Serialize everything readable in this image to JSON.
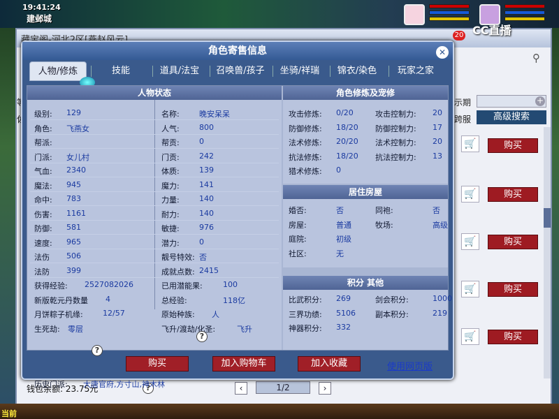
{
  "game": {
    "clock": "19:41:24",
    "location": "建邺城",
    "cc_label": "CC直播",
    "chat_count": "20"
  },
  "back_window": {
    "title": "藏宝阁-河北2区[燕赵风云]",
    "side_labels": [
      "等",
      "佐"
    ],
    "filter_label": "示期",
    "server_label": "跨服",
    "advanced_search": "高级搜索",
    "buy_labels": [
      "购买",
      "购买",
      "购买",
      "购买",
      "购买",
      "购买"
    ],
    "wallet": "钱包余额: 23.75元",
    "page": "1/2"
  },
  "modal": {
    "title": "角色寄售信息",
    "tabs": [
      "人物/修炼",
      "技能",
      "道具/法宝",
      "召唤兽/孩子",
      "坐骑/祥瑞",
      "锦衣/染色",
      "玩家之家"
    ],
    "active_tab": 0,
    "status_title": "人物状态",
    "status_left": [
      {
        "label": "级别:",
        "value": "129"
      },
      {
        "label": "角色:",
        "value": "飞燕女"
      },
      {
        "label": "帮派:",
        "value": ""
      },
      {
        "label": "门派:",
        "value": "女儿村"
      },
      {
        "label": "气血:",
        "value": "2340"
      },
      {
        "label": "魔法:",
        "value": "945"
      },
      {
        "label": "命中:",
        "value": "783"
      },
      {
        "label": "伤害:",
        "value": "1161"
      },
      {
        "label": "防御:",
        "value": "581"
      },
      {
        "label": "速度:",
        "value": "965"
      },
      {
        "label": "法伤",
        "value": "506"
      },
      {
        "label": "法防",
        "value": "399"
      }
    ],
    "status_right": [
      {
        "label": "名称:",
        "value": "晚安呆呆"
      },
      {
        "label": "人气:",
        "value": "800"
      },
      {
        "label": "帮贡:",
        "value": "0"
      },
      {
        "label": "门贡:",
        "value": "242"
      },
      {
        "label": "体质:",
        "value": "139"
      },
      {
        "label": "魔力:",
        "value": "141"
      },
      {
        "label": "力量:",
        "value": "140"
      },
      {
        "label": "耐力:",
        "value": "140"
      },
      {
        "label": "敏捷:",
        "value": "976"
      },
      {
        "label": "潜力:",
        "value": "0"
      },
      {
        "label": "靓号特效:",
        "value": "否"
      },
      {
        "label": "成就点数:",
        "value": "2415"
      }
    ],
    "extra_rows": [
      {
        "l1": "获得经验:",
        "v1": "2527082026",
        "l2": "已用潜能果:",
        "v2": "100"
      },
      {
        "l1": "新版乾元丹数量",
        "v1": "4",
        "l2": "总经验:",
        "v2": "118亿"
      },
      {
        "l1": "月饼粽子机缘:",
        "v1": "12/57",
        "l2": "原始种族:",
        "v2": "人"
      },
      {
        "l1": "生死劫:",
        "v1": "零层",
        "l2": "飞升/渡劫/化圣:",
        "v2": "飞升"
      }
    ],
    "history_label": "历史门派:",
    "history_value": "大唐官府,方寸山,神木林",
    "cultivation_title": "角色修炼及宠修",
    "cultivation": [
      {
        "l1": "攻击修炼:",
        "v1": "0/20",
        "l2": "攻击控制力:",
        "v2": "20"
      },
      {
        "l1": "防御修炼:",
        "v1": "18/20",
        "l2": "防御控制力:",
        "v2": "17"
      },
      {
        "l1": "法术修炼:",
        "v1": "20/20",
        "l2": "法术控制力:",
        "v2": "20"
      },
      {
        "l1": "抗法修炼:",
        "v1": "18/20",
        "l2": "抗法控制力:",
        "v2": "13"
      },
      {
        "l1": "猎术修炼:",
        "v1": "0",
        "l2": "",
        "v2": ""
      }
    ],
    "house_title": "居住房屋",
    "house": [
      {
        "l1": "婚否:",
        "v1": "否",
        "l2": "同袍:",
        "v2": "否"
      },
      {
        "l1": "房屋:",
        "v1": "普通",
        "l2": "牧场:",
        "v2": "高级"
      },
      {
        "l1": "庭院:",
        "v1": "初级",
        "l2": "",
        "v2": ""
      },
      {
        "l1": "社区:",
        "v1": "无",
        "l2": "",
        "v2": ""
      }
    ],
    "points_title": "积分 其他",
    "points": [
      {
        "l1": "比武积分:",
        "v1": "269",
        "l2": "剑会积分:",
        "v2": "1000"
      },
      {
        "l1": "三界功绩:",
        "v1": "5106",
        "l2": "副本积分:",
        "v2": "219"
      },
      {
        "l1": "神器积分:",
        "v1": "332",
        "l2": "",
        "v2": ""
      }
    ],
    "buttons": {
      "buy": "购买",
      "add_cart": "加入购物车",
      "add_fav": "加入收藏",
      "web_version": "使用网页版"
    }
  },
  "colors": {
    "accent_red": "#a01f27",
    "value_blue": "#1a3aa0",
    "panel_bg": "#b9c4de",
    "modal_bg": "#3a5a8c"
  }
}
